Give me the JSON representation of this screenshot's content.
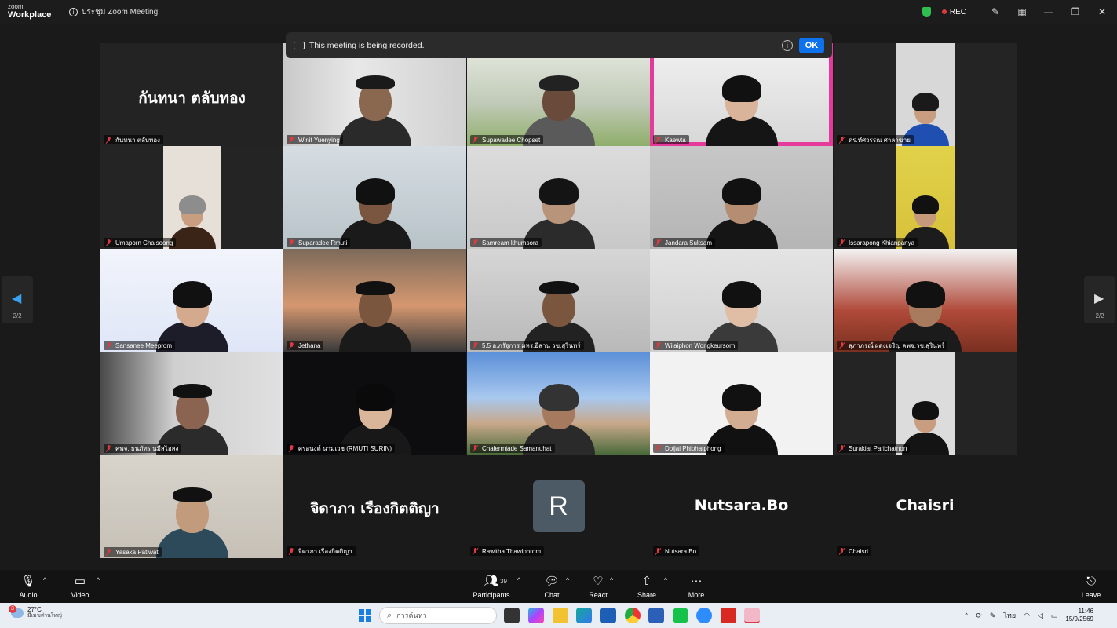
{
  "titlebar": {
    "brand_top": "zoom",
    "brand_bottom": "Workplace",
    "meeting_title": "ประชุม Zoom Meeting",
    "rec_label": "REC"
  },
  "banner": {
    "text": "This meeting is being recorded.",
    "ok_label": "OK"
  },
  "nav": {
    "page_left": "2/2",
    "page_right": "2/2"
  },
  "participants": [
    {
      "name": "กันทนา ตลับทอง",
      "display": "กันทนา ตลับทอง",
      "video": false
    },
    {
      "name": "Winit Yuenying",
      "video": true
    },
    {
      "name": "Supawadee Chopset",
      "video": true
    },
    {
      "name": "Kaewta",
      "video": true
    },
    {
      "name": "ดร.ทัศวรรณ ศาลาฆาย",
      "video": true
    },
    {
      "name": "Umaporn Chaisoong",
      "video": true
    },
    {
      "name": "Suparadee Rmuti",
      "video": true
    },
    {
      "name": "Samream khumsora",
      "video": true
    },
    {
      "name": "Jandara Suksam",
      "video": true
    },
    {
      "name": "Issarapong Khianpanya",
      "video": true
    },
    {
      "name": "Sansanee Meeprom",
      "video": true
    },
    {
      "name": "Jethana",
      "video": true
    },
    {
      "name": "5.5 อ.ภรัฐการ มหร.อีสาน วข.สุรินทร์",
      "video": true
    },
    {
      "name": "Wilaiphon Wongkeursorn",
      "video": true
    },
    {
      "name": "สุภาภรณ์ ผดุงเจริญ คพจ.วข.สุรินทร์",
      "video": true
    },
    {
      "name": "คพจ. ธนภัทร นมีสไอสง",
      "video": true
    },
    {
      "name": "ศรอนงค์ นามเวช (RMUTI SURIN)",
      "video": true
    },
    {
      "name": "Chalermjade Samanuhat",
      "video": true
    },
    {
      "name": "Doljai Phiphatphong",
      "video": true
    },
    {
      "name": "Surakiat Parichatnon",
      "video": true
    },
    {
      "name": "Yasaka Patiwat",
      "video": true
    },
    {
      "name": "จิดาภา เรืองกิตติญา",
      "display": "จิดาภา เรืองกิตติญา",
      "video": false
    },
    {
      "name": "Rawitha Thawiphrom",
      "avatar_letter": "R",
      "video": false
    },
    {
      "name": "Nutsara.Bo",
      "display": "Nutsara.Bo",
      "video": false
    },
    {
      "name": "Chaisri",
      "display": "Chaisri",
      "video": false
    }
  ],
  "toolbar": {
    "audio": "Audio",
    "video": "Video",
    "participants": "Participants",
    "participants_count": "39",
    "chat": "Chat",
    "react": "React",
    "share": "Share",
    "more": "More",
    "leave": "Leave"
  },
  "taskbar": {
    "weather_temp": "27°C",
    "weather_desc": "มีเมฆส่วนใหญ่",
    "weather_badge": "3",
    "search_placeholder": "การค้นหา",
    "lang": "ไทย",
    "time": "11:46",
    "date": "15/9/2569"
  },
  "colors": {
    "accent": "#0e72ed",
    "mute_red": "#e0393e",
    "secure_green": "#2fbf4f"
  }
}
